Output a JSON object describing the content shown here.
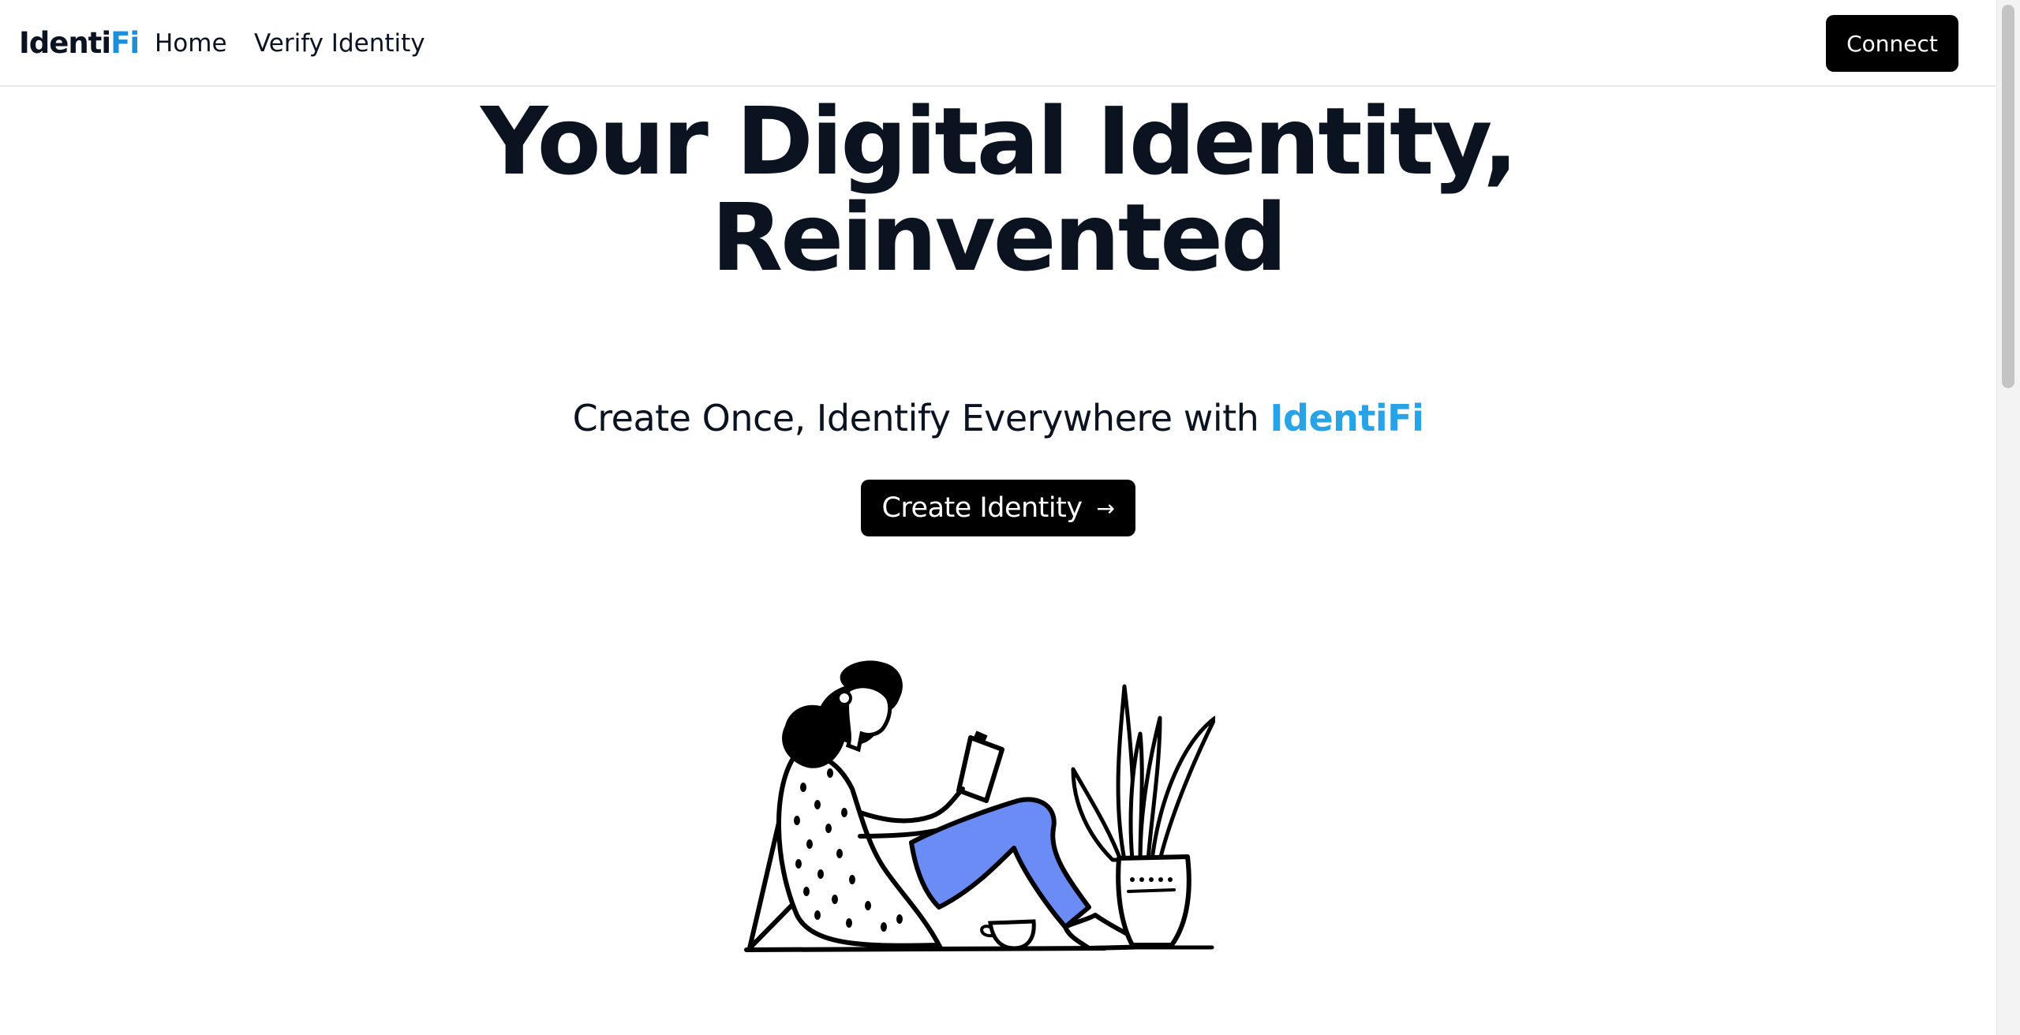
{
  "nav": {
    "logo_part1": "Identi",
    "logo_part2": "Fi",
    "links": [
      {
        "label": "Home"
      },
      {
        "label": "Verify Identity"
      }
    ],
    "connect_label": "Connect"
  },
  "hero": {
    "title_line1": "Your Digital Identity,",
    "title_line2": "Reinvented",
    "subtitle_prefix": "Create Once, Identify Everywhere with ",
    "subtitle_brand": "IdentiFi",
    "cta_label": "Create Identity",
    "cta_icon": "arrow-right-icon"
  },
  "illustration": {
    "subject": "person-reading-phone-illustration"
  },
  "colors": {
    "brand_blue": "#27a3e6",
    "logo_blue": "#1e8fd6",
    "button_bg": "#000000",
    "text_dark": "#0b1220",
    "pants_blue": "#6b8cf5"
  }
}
